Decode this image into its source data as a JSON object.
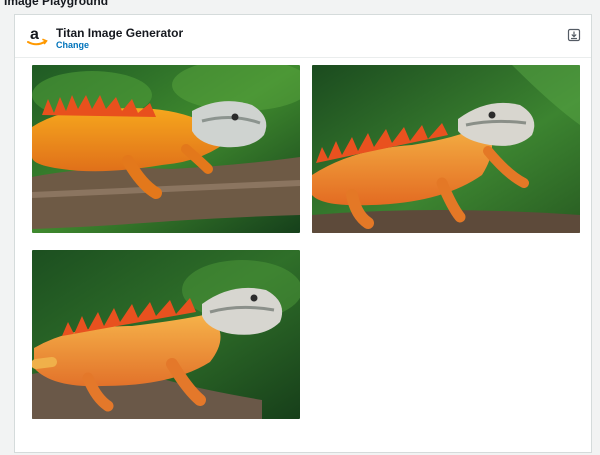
{
  "page": {
    "top_fragment": "Image Playground"
  },
  "model_selector": {
    "name": "Titan Image Generator",
    "change_label": "Change",
    "logo_icon": "amazon-logo-icon"
  },
  "actions": {
    "save_icon": "download-icon"
  },
  "results": {
    "images": [
      {
        "subject": "orange iguana on branch",
        "icon": "generated-image"
      },
      {
        "subject": "orange iguana on branch",
        "icon": "generated-image"
      },
      {
        "subject": "orange iguana on branch",
        "icon": "generated-image"
      }
    ]
  },
  "colors": {
    "accent_link": "#0073bb",
    "amazon_orange": "#ff9900",
    "panel_bg": "#ffffff",
    "page_bg": "#f2f3f3"
  }
}
